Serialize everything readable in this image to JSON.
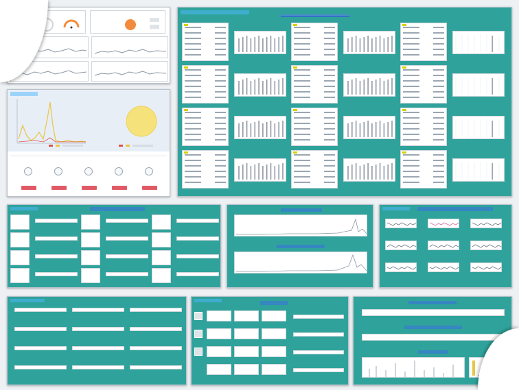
{
  "dashboard": {
    "colors": {
      "teal": "#2fa39b",
      "title_blue": "#1b2fe0",
      "chart_yellow": "#e8c547",
      "chart_red": "#d9534f",
      "orange": "#f28c3c"
    }
  },
  "topleft": {
    "top_cards": [
      "",
      "",
      ""
    ],
    "left_charts": [
      "",
      "",
      "",
      ""
    ]
  },
  "middleleft": {
    "header_left": "",
    "header_right": "",
    "legend_a": "",
    "legend_b": "",
    "info_left": "",
    "info_mid": "",
    "info_right": "",
    "actions": [
      {
        "label": "",
        "icon": "user-icon"
      },
      {
        "label": "",
        "icon": "copy-icon"
      },
      {
        "label": "",
        "icon": "download-icon"
      },
      {
        "label": "",
        "icon": "gear-icon"
      },
      {
        "label": "",
        "icon": "chart-icon"
      }
    ]
  },
  "main_monitor": {
    "title": "",
    "breadcrumb": "",
    "grid_rows": 4,
    "grid_cols": 3
  },
  "row2": {
    "panelA_title": "",
    "panelB_title1": "",
    "panelB_title2": "",
    "panelC_title": ""
  },
  "row3": {
    "panelD_title": "",
    "panelE_title": "",
    "panelF_title1": "",
    "panelF_title2": "",
    "panelF_title3": ""
  }
}
